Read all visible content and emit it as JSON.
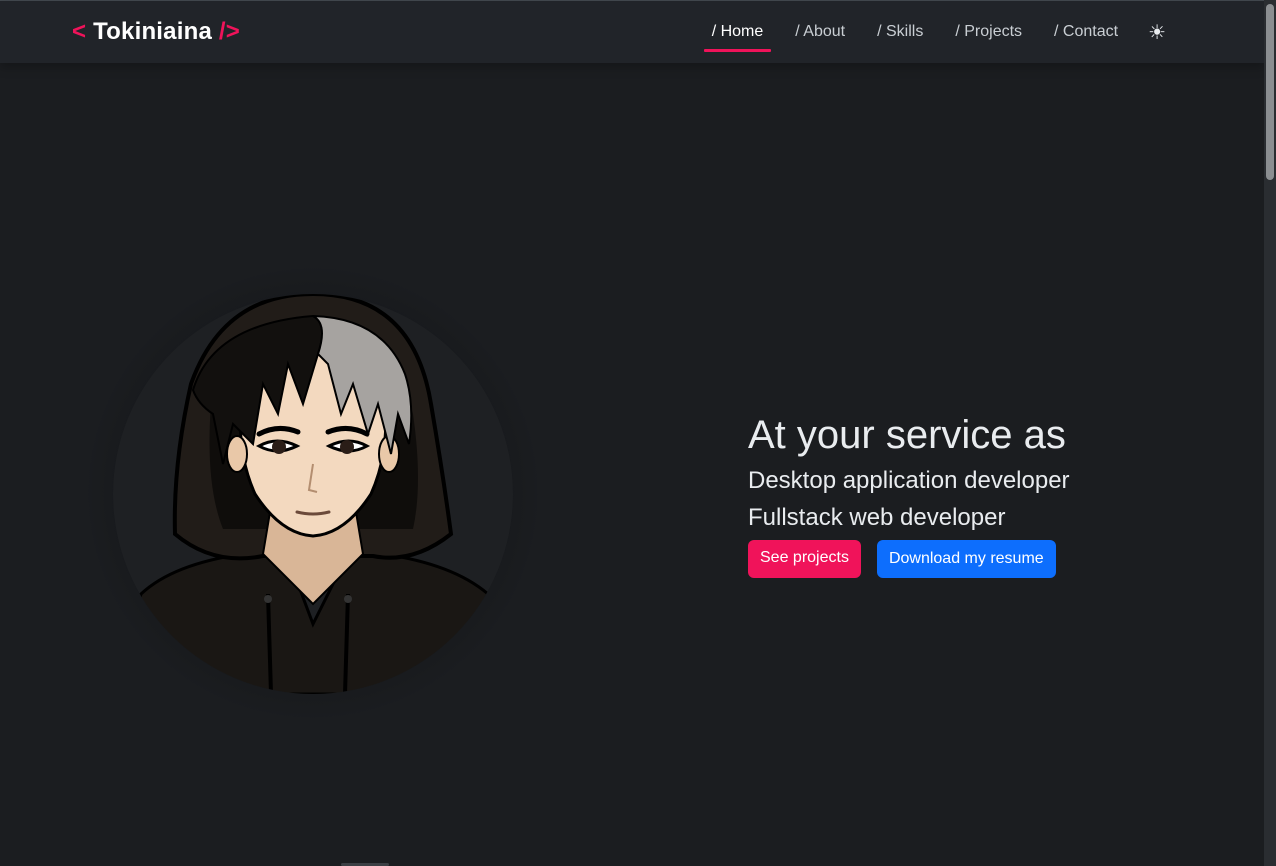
{
  "brand": {
    "open": "<",
    "name": "Tokiniaina",
    "close": "/>"
  },
  "nav": {
    "items": [
      {
        "label": "/ Home",
        "active": true
      },
      {
        "label": "/ About"
      },
      {
        "label": "/ Skills"
      },
      {
        "label": "/ Projects"
      },
      {
        "label": "/ Contact"
      }
    ],
    "theme_icon": "☀"
  },
  "hero": {
    "title": "At your service as",
    "roles": [
      "Desktop application developer",
      "Fullstack web developer"
    ],
    "buttons": {
      "projects": "See projects",
      "resume": "Download my resume"
    },
    "avatar_icon": "avatar-illustration"
  },
  "colors": {
    "accent": "#f0135a",
    "primary": "#0d6efd",
    "background": "#1b1d20",
    "navbar": "#212429"
  }
}
